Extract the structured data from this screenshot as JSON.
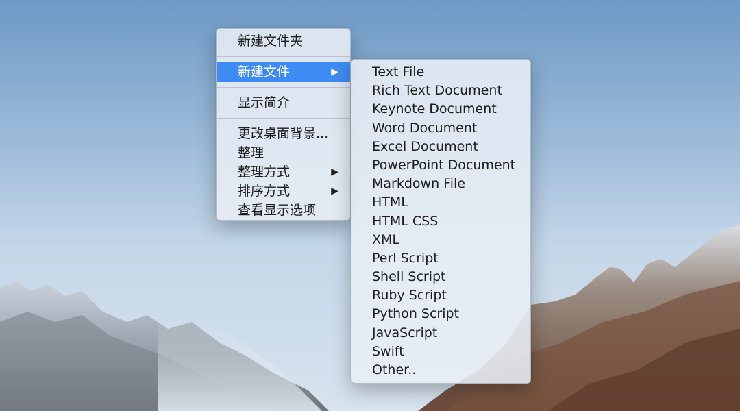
{
  "context_menu": {
    "items": [
      {
        "label": "新建文件夹"
      },
      {
        "label": "新建文件",
        "arrow": "▶",
        "highlighted": true
      },
      {
        "label": "显示简介"
      },
      {
        "label": "更改桌面背景..."
      },
      {
        "label": "整理"
      },
      {
        "label": "整理方式",
        "arrow": "▶"
      },
      {
        "label": "排序方式",
        "arrow": "▶"
      },
      {
        "label": "查看显示选项"
      }
    ]
  },
  "submenu": {
    "items": [
      "Text File",
      "Rich Text Document",
      "Keynote Document",
      "Word Document",
      "Excel Document",
      "PowerPoint Document",
      "Markdown File",
      "HTML",
      "HTML CSS",
      "XML",
      "Perl Script",
      "Shell Script",
      "Ruby Script",
      "Python Script",
      "JavaScript",
      "Swift",
      "Other.."
    ]
  },
  "colors": {
    "highlight": "#3e8bf3",
    "menu_background": "#e8eef5",
    "sky_top": "#6e9ac6"
  },
  "icons": [
    "submenu-arrow-icon"
  ]
}
